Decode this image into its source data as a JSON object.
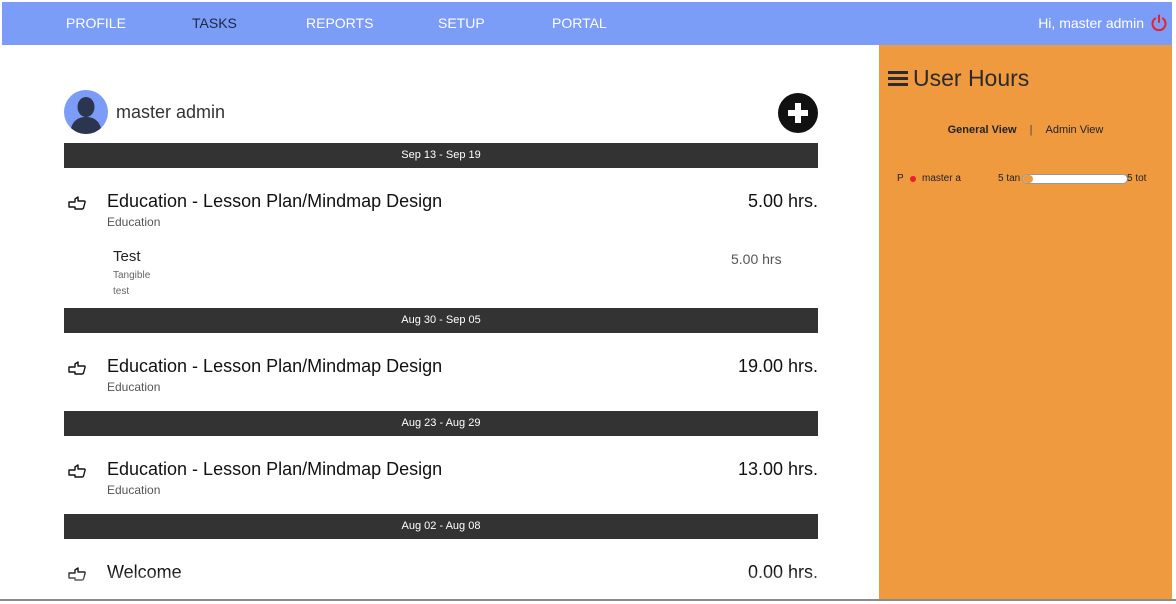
{
  "nav": {
    "items": [
      {
        "label": "PROFILE",
        "active": false
      },
      {
        "label": "TASKS",
        "active": true
      },
      {
        "label": "REPORTS",
        "active": false
      },
      {
        "label": "SETUP",
        "active": false
      },
      {
        "label": "PORTAL",
        "active": false
      }
    ],
    "greeting": "Hi, master admin",
    "logout_icon": "power-icon"
  },
  "profile": {
    "name": "master admin",
    "avatar_icon": "user-silhouette-icon",
    "add_icon": "plus-circle-icon"
  },
  "weeks": [
    {
      "range": "Sep 13 - Sep 19",
      "tasks": [
        {
          "title": "Education - Lesson Plan/Mindmap Design",
          "category": "Education",
          "hours": "5.00 hrs.",
          "entries": [
            {
              "title": "Test",
              "type": "Tangible",
              "note": "test",
              "hours": "5.00 hrs"
            }
          ]
        }
      ]
    },
    {
      "range": "Aug 30 - Sep 05",
      "tasks": [
        {
          "title": "Education - Lesson Plan/Mindmap Design",
          "category": "Education",
          "hours": "19.00 hrs."
        }
      ]
    },
    {
      "range": "Aug 23 - Aug 29",
      "tasks": [
        {
          "title": "Education - Lesson Plan/Mindmap Design",
          "category": "Education",
          "hours": "13.00 hrs."
        }
      ]
    },
    {
      "range": "Aug 02 - Aug 08",
      "tasks": [
        {
          "title": "Welcome",
          "hours": "0.00 hrs."
        }
      ]
    }
  ],
  "side_panel": {
    "title": "User Hours",
    "menu_icon": "hamburger-icon",
    "tabs": [
      {
        "label": "General View",
        "selected": true
      },
      {
        "label": "Admin View",
        "selected": false
      }
    ],
    "separator": "|",
    "user_hours": [
      {
        "initial": "P",
        "name": "master a",
        "tangible": "5 tan",
        "total": "5 tot",
        "status_color": "#e8202a",
        "fill_fraction": 0.1
      }
    ]
  },
  "colors": {
    "nav_bg": "#7b9cf7",
    "panel_bg": "#f09a40",
    "week_bar_bg": "#333333"
  }
}
